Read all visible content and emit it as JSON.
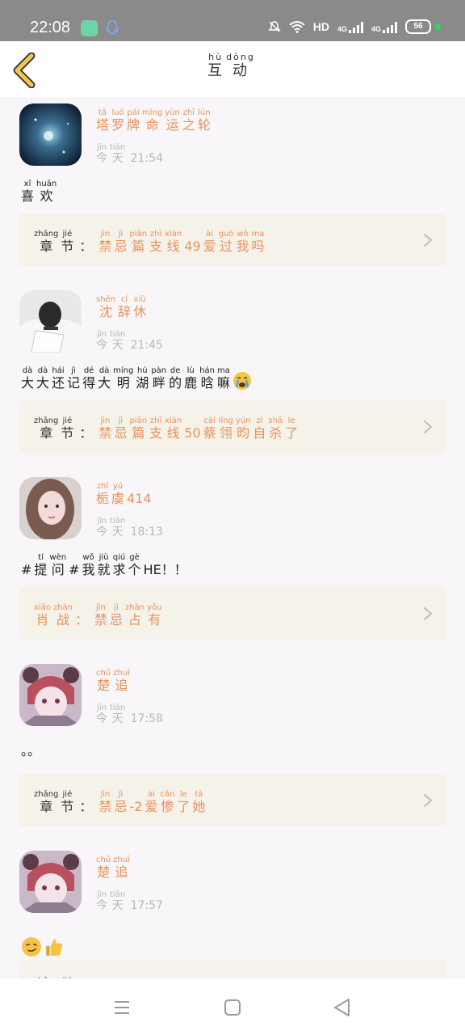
{
  "status_bar": {
    "time": "22:08",
    "network_label": "HD",
    "signal_label_1": "4G",
    "signal_label_2": "4G",
    "battery": "56"
  },
  "header": {
    "title_chars": [
      "互",
      "动"
    ],
    "title_pinyin": [
      "hù",
      "dòng"
    ],
    "back_icon": "chevron-left-icon"
  },
  "chapter_label": {
    "chars": [
      "章",
      "节"
    ],
    "pinyin": [
      "zhāng",
      "jié"
    ],
    "colon": "："
  },
  "time_label": {
    "chars": [
      "今",
      "天"
    ],
    "pinyin": [
      "jīn",
      "tiān"
    ]
  },
  "posts": [
    {
      "username": [
        [
          "塔",
          "tǎ"
        ],
        [
          "罗",
          "luó"
        ],
        [
          "牌",
          "pái"
        ],
        [
          "命",
          "mìng"
        ],
        [
          "运",
          "yùn"
        ],
        [
          "之",
          "zhī"
        ],
        [
          "轮",
          "lún"
        ]
      ],
      "time": "21:54",
      "content": [
        [
          "喜",
          "xǐ"
        ],
        [
          "欢",
          "huān"
        ]
      ],
      "chapter_prefix": "chapter",
      "chapter_title": [
        [
          "禁",
          "jìn"
        ],
        [
          "忌",
          "jì"
        ],
        [
          "篇",
          "piān"
        ],
        [
          "支",
          "zhī"
        ],
        [
          "线",
          "xiàn"
        ],
        [
          "49",
          ""
        ],
        [
          "爱",
          "ài"
        ],
        [
          "过",
          "guò"
        ],
        [
          "我",
          "wǒ"
        ],
        [
          "吗",
          "ma"
        ]
      ]
    },
    {
      "username": [
        [
          "沈",
          "shěn"
        ],
        [
          "辞",
          "cí"
        ],
        [
          "休",
          "xiū"
        ]
      ],
      "time": "21:45",
      "content": [
        [
          "大",
          "dà"
        ],
        [
          "大",
          "dà"
        ],
        [
          "还",
          "hái"
        ],
        [
          "记",
          "jì"
        ],
        [
          "得",
          "dé"
        ],
        [
          "大",
          "dà"
        ],
        [
          "明",
          "míng"
        ],
        [
          "湖",
          "hú"
        ],
        [
          "畔",
          "pàn"
        ],
        [
          "的",
          "de"
        ],
        [
          "鹿",
          "lù"
        ],
        [
          "晗",
          "hán"
        ],
        [
          "嘛",
          "ma"
        ]
      ],
      "content_emoji": "crying-face-icon",
      "chapter_prefix": "chapter",
      "chapter_title": [
        [
          "禁",
          "jìn"
        ],
        [
          "忌",
          "jì"
        ],
        [
          "篇",
          "piān"
        ],
        [
          "支",
          "zhī"
        ],
        [
          "线",
          "xiàn"
        ],
        [
          "50",
          ""
        ],
        [
          "蔡",
          "cài"
        ],
        [
          "翎",
          "líng"
        ],
        [
          "昀",
          "yún"
        ],
        [
          "自",
          "zì"
        ],
        [
          "杀",
          "shā"
        ],
        [
          "了",
          "le"
        ]
      ]
    },
    {
      "username": [
        [
          "栀",
          "zhī"
        ],
        [
          "虞",
          "yú"
        ],
        [
          "414",
          ""
        ]
      ],
      "time": "18:13",
      "content": [
        [
          "#",
          ""
        ],
        [
          "提",
          "tí"
        ],
        [
          "问",
          "wèn"
        ],
        [
          "#",
          ""
        ],
        [
          "我",
          "wǒ"
        ],
        [
          "就",
          "jiù"
        ],
        [
          "求",
          "qiú"
        ],
        [
          "个",
          "gè"
        ],
        [
          "HE！！",
          ""
        ]
      ],
      "chapter_prefix": "custom",
      "chapter_prefix_chars": [
        [
          "肖",
          "xiāo"
        ],
        [
          "战",
          "zhàn"
        ]
      ],
      "chapter_title": [
        [
          "禁",
          "jìn"
        ],
        [
          "忌",
          "jì"
        ],
        [
          "占",
          "zhàn"
        ],
        [
          "有",
          "yǒu"
        ]
      ]
    },
    {
      "username": [
        [
          "楚",
          "chǔ"
        ],
        [
          "追",
          "zhuī"
        ]
      ],
      "time": "17:58",
      "content": [
        [
          "。。",
          ""
        ]
      ],
      "chapter_prefix": "chapter",
      "chapter_title": [
        [
          "禁",
          "jìn"
        ],
        [
          "忌",
          "jì"
        ],
        [
          "-2",
          ""
        ],
        [
          "爱",
          "ài"
        ],
        [
          "惨",
          "cǎn"
        ],
        [
          "了",
          "le"
        ],
        [
          "她",
          "tā"
        ]
      ]
    },
    {
      "username": [
        [
          "楚",
          "chǔ"
        ],
        [
          "追",
          "zhuī"
        ]
      ],
      "time": "17:57",
      "content": [],
      "content_emojis": [
        "smirking-face-icon",
        "thumbs-up-icon"
      ],
      "chapter_prefix": "chapter",
      "chapter_title": []
    }
  ],
  "nav": {
    "menu_icon": "menu-icon",
    "home_icon": "home-square-icon",
    "back_icon": "back-triangle-icon"
  },
  "colors": {
    "accent": "#e8925b",
    "card_bg": "#f4f2e9",
    "status_bar": "#8a8a8a",
    "back_chevron": "#d9b33a"
  }
}
